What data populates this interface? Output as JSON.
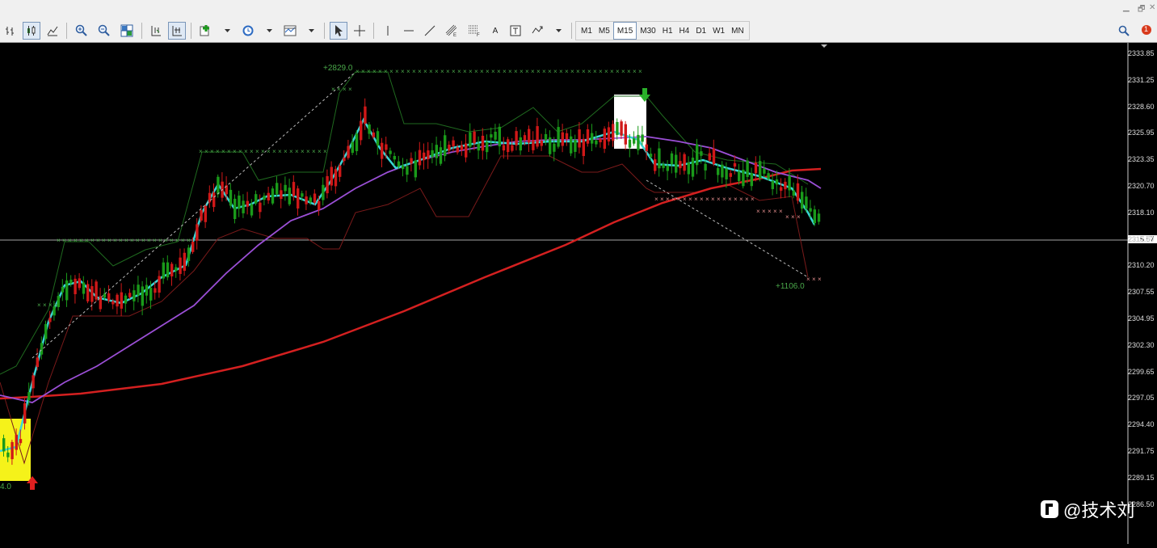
{
  "window": {
    "minimize_glyph": "▁",
    "restore_glyph": "🗗",
    "close_glyph": "✕"
  },
  "toolbar": {
    "timeframes": [
      "M1",
      "M5",
      "M15",
      "M30",
      "H1",
      "H4",
      "D1",
      "W1",
      "MN"
    ],
    "active_timeframe": "M15",
    "notification_count": "1",
    "draw_tools": {
      "text_label": "A"
    }
  },
  "chart": {
    "price_axis": [
      "2333.85",
      "2331.25",
      "2328.60",
      "2325.95",
      "2323.35",
      "2320.70",
      "2318.10",
      "2315.57",
      "2312.80",
      "2310.20",
      "2307.55",
      "2304.95",
      "2302.30",
      "2299.65",
      "2297.05",
      "2294.40",
      "2291.75",
      "2289.15",
      "2286.50"
    ],
    "current_price": "2315.57",
    "annotations": {
      "top_profit": "+2829.0",
      "bottom_profit": "+1106.0",
      "left_partial": "4.0"
    },
    "colors": {
      "background": "#000000",
      "bull_candle": "#1a9a1a",
      "bear_candle": "#d01818",
      "ma_fast": "#39d6d6",
      "ma_mid": "#9b4fd6",
      "ma_slow": "#d42020",
      "channel": "#7a1a1a",
      "channel_green": "#1f6a1f"
    }
  },
  "watermark": {
    "text": "@技术刘"
  }
}
